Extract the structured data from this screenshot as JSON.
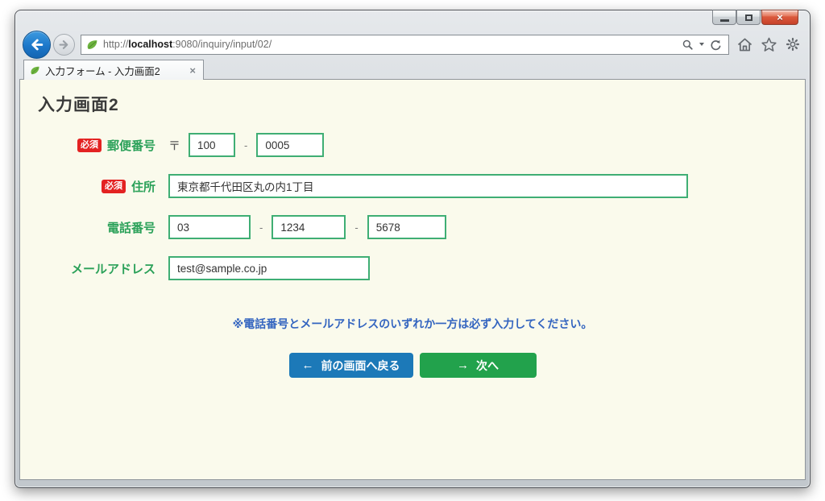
{
  "window": {
    "controls": {
      "minimize": "minimize-icon",
      "restore": "restore-icon",
      "close_glyph": "×"
    }
  },
  "browser": {
    "url": {
      "scheme": "http://",
      "host": "localhost",
      "rest": ":9080/inquiry/input/02/"
    },
    "tab": {
      "title": "入力フォーム - 入力画面2",
      "close_glyph": "×"
    },
    "icons": {
      "back": "back-arrow",
      "forward": "forward-arrow",
      "favicon": "spring-leaf",
      "search": "magnifier",
      "search_dropdown": "caret-down",
      "refresh": "refresh-arrow",
      "home": "home",
      "favorites": "star",
      "tools": "gear"
    }
  },
  "page": {
    "title": "入力画面2",
    "required_badge": "必須",
    "postal_prefix": "〒",
    "fields": [
      {
        "label": "郵便番号",
        "required": true,
        "sep": "-",
        "inputs": [
          "100",
          "0005"
        ]
      },
      {
        "label": "住所",
        "required": true,
        "inputs": [
          "東京都千代田区丸の内1丁目"
        ]
      },
      {
        "label": "電話番号",
        "required": false,
        "sep": "-",
        "inputs": [
          "03",
          "1234",
          "5678"
        ]
      },
      {
        "label": "メールアドレス",
        "required": false,
        "inputs": [
          "test@sample.co.jp"
        ]
      }
    ],
    "note": "※電話番号とメールアドレスのいずれか一方は必ず入力してください。",
    "buttons": {
      "back_arrow": "←",
      "back_label": "前の画面へ戻る",
      "next_arrow": "→",
      "next_label": "次へ"
    },
    "colors": {
      "accent_green": "#2ba159",
      "input_border_green": "#3fae74",
      "required_red": "#e32222",
      "note_blue": "#3465c0",
      "button_blue": "#1c79b8",
      "button_green": "#22a24c",
      "page_bg": "#fafaec",
      "back_circle_blue": "#1c77c9"
    }
  }
}
